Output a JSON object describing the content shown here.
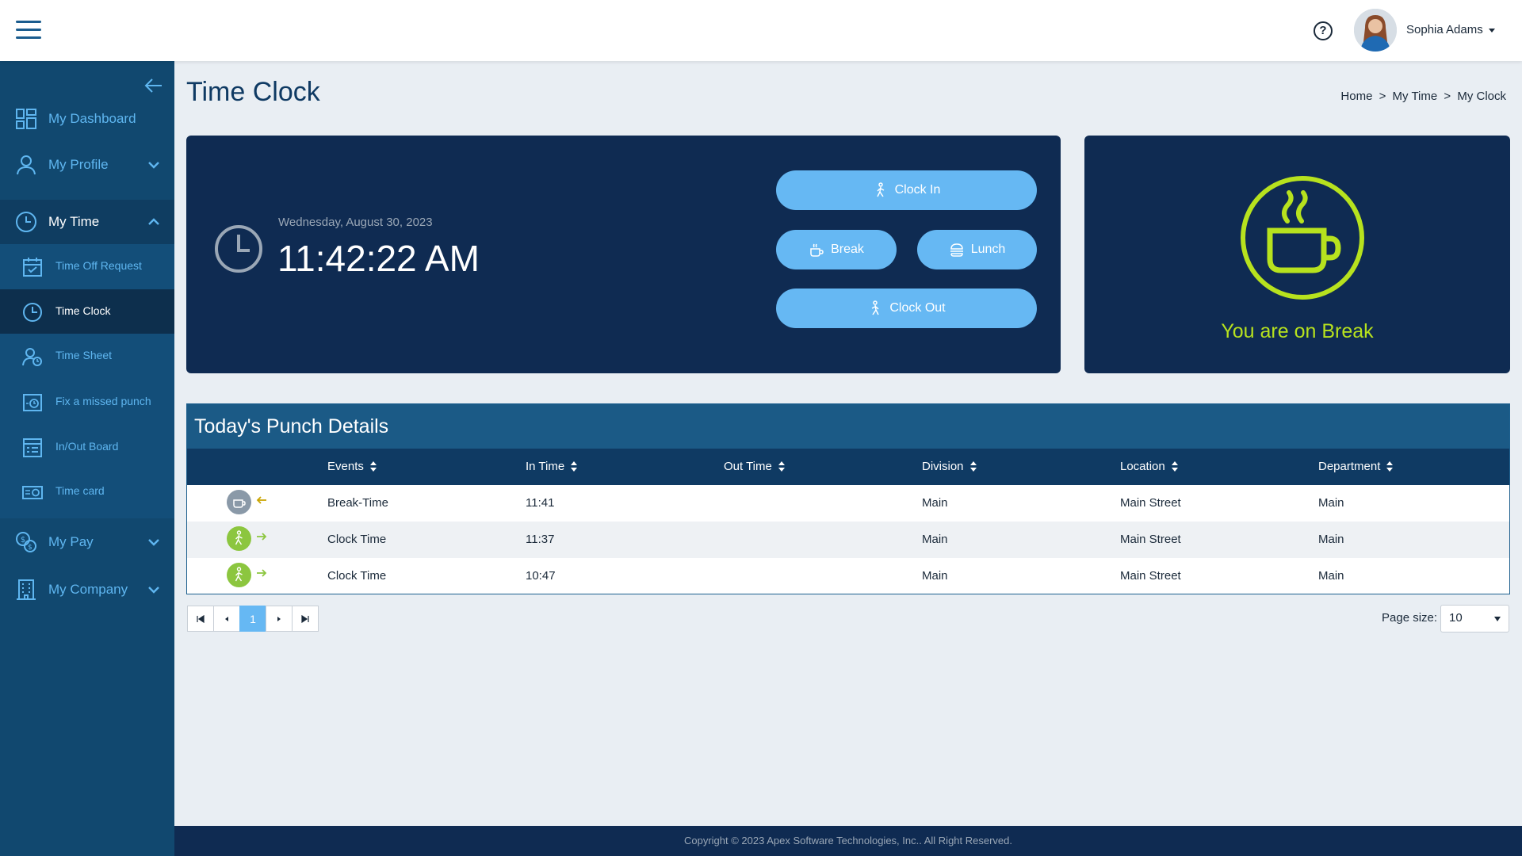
{
  "header": {
    "help_label": "?",
    "user_name": "Sophia Adams"
  },
  "sidebar": {
    "items": [
      {
        "label": "My Dashboard"
      },
      {
        "label": "My Profile"
      },
      {
        "label": "My Time"
      },
      {
        "label": "My Pay"
      },
      {
        "label": "My Company"
      }
    ],
    "time_sub_items": [
      {
        "label": "Time Off Request"
      },
      {
        "label": "Time Clock"
      },
      {
        "label": "Time Sheet"
      },
      {
        "label": "Fix a missed punch"
      },
      {
        "label": "In/Out Board"
      },
      {
        "label": "Time card"
      }
    ]
  },
  "page": {
    "title": "Time Clock",
    "breadcrumb": [
      "Home",
      ">",
      "My Time",
      ">",
      "My Clock"
    ]
  },
  "clock": {
    "date": "Wednesday, August 30, 2023",
    "time": "11:42:22 AM",
    "buttons": {
      "clock_in": "Clock In",
      "break": "Break",
      "lunch": "Lunch",
      "clock_out": "Clock Out"
    }
  },
  "status": {
    "text": "You are on Break",
    "color": "#b7e21e"
  },
  "punch_table": {
    "title": "Today's Punch Details",
    "columns": [
      "Events",
      "In Time",
      "Out Time",
      "Division",
      "Location",
      "Department"
    ],
    "rows": [
      {
        "event": "Break-Time",
        "in_time": "11:41",
        "out_time": "",
        "division": "Main",
        "location": "Main Street",
        "department": "Main",
        "icon": "coffee-icon",
        "direction": "left"
      },
      {
        "event": "Clock Time",
        "in_time": "11:37",
        "out_time": "",
        "division": "Main",
        "location": "Main Street",
        "department": "Main",
        "icon": "walking-person-icon",
        "direction": "right"
      },
      {
        "event": "Clock Time",
        "in_time": "10:47",
        "out_time": "",
        "division": "Main",
        "location": "Main Street",
        "department": "Main",
        "icon": "walking-person-icon",
        "direction": "right"
      }
    ]
  },
  "pagination": {
    "current_page": "1",
    "page_size_label": "Page size:",
    "page_size": "10"
  },
  "footer": {
    "text": "Copyright © 2023 Apex Software Technologies, Inc.. All Right Reserved."
  },
  "colors": {
    "sidebar": "#11486f",
    "card": "#0f2b52",
    "accent": "#66b8f3",
    "break_green": "#b7e21e"
  }
}
